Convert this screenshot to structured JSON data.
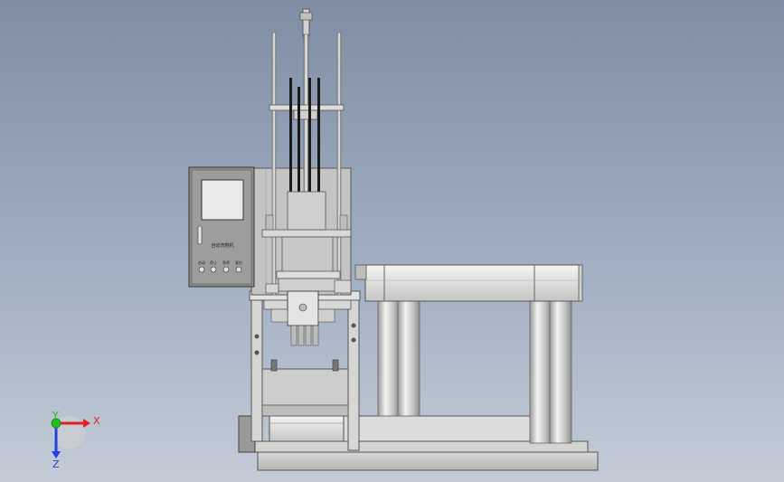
{
  "control_panel": {
    "label": "自动洗鞋机",
    "buttons": [
      "启动",
      "停止",
      "急停",
      "复位"
    ]
  },
  "triad": {
    "x_label": "X",
    "y_label": "Y",
    "z_label": "Z"
  },
  "colors": {
    "background_top": "#7f8ea4",
    "background_bottom": "#c3cbd6",
    "metal_light": "#e8e8e6",
    "metal_mid": "#c9c9c7",
    "metal_dark": "#8a8a88",
    "x_axis": "#e02020",
    "y_axis": "#20c020",
    "z_axis": "#2040e0"
  }
}
